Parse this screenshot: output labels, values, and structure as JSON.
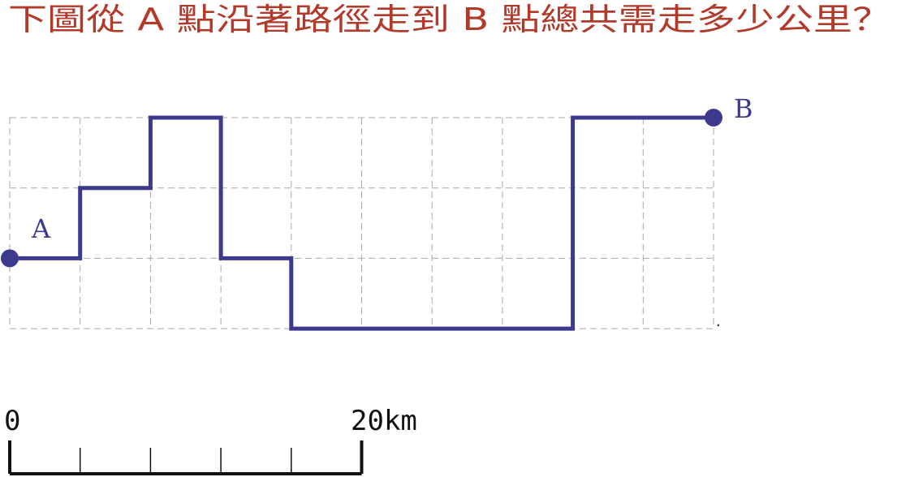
{
  "question": {
    "text": "下圖從 A 點沿著路徑走到 B 點總共需走多少公里？"
  },
  "grid": {
    "columns": 10,
    "rows": 3
  },
  "path": {
    "start_label": "A",
    "end_label": "B",
    "cells": [
      [
        0,
        2
      ],
      [
        1,
        2
      ],
      [
        1,
        1
      ],
      [
        2,
        1
      ],
      [
        2,
        0
      ],
      [
        3,
        0
      ],
      [
        3,
        2
      ],
      [
        4,
        2
      ],
      [
        4,
        3
      ],
      [
        8,
        3
      ],
      [
        8,
        0
      ],
      [
        10,
        0
      ]
    ]
  },
  "scale": {
    "start_label": "0",
    "end_label": "20km",
    "divisions": 5
  },
  "colors": {
    "path": "#3d3a8e",
    "question": "#b23a2a",
    "grid": "#a8a8a8",
    "scale": "#111111"
  }
}
